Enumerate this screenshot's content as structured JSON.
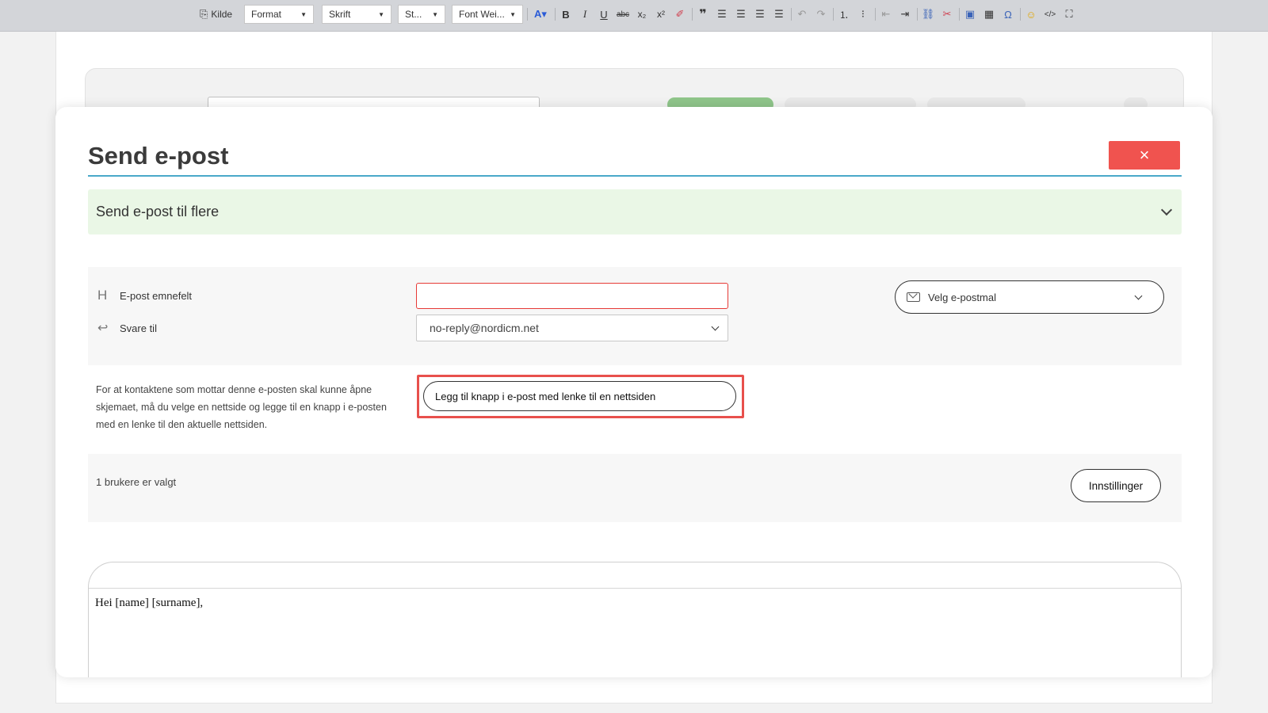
{
  "rte_toolbar": {
    "source_label": "Kilde",
    "format_label": "Format",
    "font_label": "Skrift",
    "size_label": "St...",
    "weight_label": "Font Wei...",
    "buttons": [
      "font-color",
      "bold",
      "italic",
      "underline",
      "strikethrough",
      "subscript",
      "superscript",
      "remove-format",
      "blockquote",
      "align-left",
      "align-center",
      "align-right",
      "justify",
      "undo",
      "redo",
      "numbered-list",
      "bulleted-list",
      "outdent",
      "indent",
      "link",
      "unlink",
      "image",
      "table",
      "special-chars",
      "emoji",
      "source",
      "maximize"
    ]
  },
  "modal": {
    "title": "Send e-post",
    "close_glyph": "×",
    "accordion_label": "Send e-post til flere",
    "subject_label": "E-post emnefelt",
    "subject_value": "",
    "reply_to_label": "Svare til",
    "reply_to_value": "no-reply@nordicm.net",
    "template_button": "Velg e-postmal",
    "info_text": "For at kontaktene som mottar denne e-posten skal kunne åpne skjemaet, må du velge en nettside og legge til en knapp i e-posten med en lenke til den aktuelle nettsiden.",
    "add_link_button": "Legg til knapp i e-post med lenke til en nettsiden",
    "users_selected": "1 brukere er valgt",
    "settings_button": "Innstillinger",
    "editor_body": "Hei [name] [surname],"
  },
  "colors": {
    "accent_rule": "#4aa8c9",
    "close_button": "#f0534f",
    "accordion_bg": "#eaf7e6",
    "error_border": "#e63a36",
    "highlight": "#e8504c"
  }
}
